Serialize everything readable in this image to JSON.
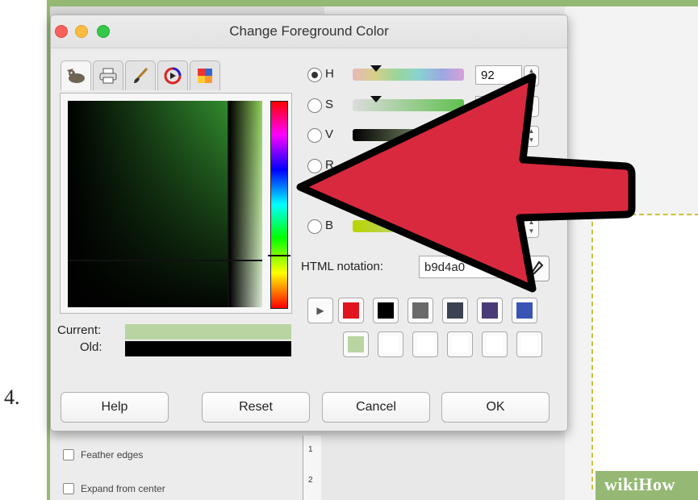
{
  "step_number": "4.",
  "dialog": {
    "title": "Change Foreground Color",
    "tabs": [
      "gimp-wilber-icon",
      "printer-icon",
      "brush-icon",
      "color-wheel-icon",
      "palette-icon"
    ],
    "current_label": "Current:",
    "old_label": "Old:",
    "current_color": "#b9d4a0",
    "old_color": "#000000",
    "channels": {
      "h": {
        "label": "H",
        "value": "92"
      },
      "s": {
        "label": "S",
        "value": ""
      },
      "v": {
        "label": "V",
        "value": ""
      },
      "r": {
        "label": "R",
        "value": ""
      },
      "b": {
        "label": "B",
        "value": ""
      }
    },
    "html_notation_label": "HTML notation:",
    "html_notation_value": "b9d4a0",
    "swatches_row1": [
      "#e0151e",
      "#000000",
      "#6a6a6a",
      "#3d4252",
      "#4b3a78",
      "#3a54b4"
    ],
    "swatches_row2": [
      "#b9d4a0",
      "#ffffff",
      "#ffffff",
      "#ffffff",
      "#ffffff",
      "#ffffff"
    ],
    "buttons": {
      "help": "Help",
      "reset": "Reset",
      "cancel": "Cancel",
      "ok": "OK"
    }
  },
  "background_options": {
    "feather_edges": "Feather edges",
    "expand_from_center": "Expand from center"
  },
  "ruler_marks": [
    "1",
    "2"
  ],
  "watermark": "wikiHow",
  "colors": {
    "frame": "#95b974",
    "arrow": "#d9293f",
    "selection_border": "#c9c23a"
  }
}
